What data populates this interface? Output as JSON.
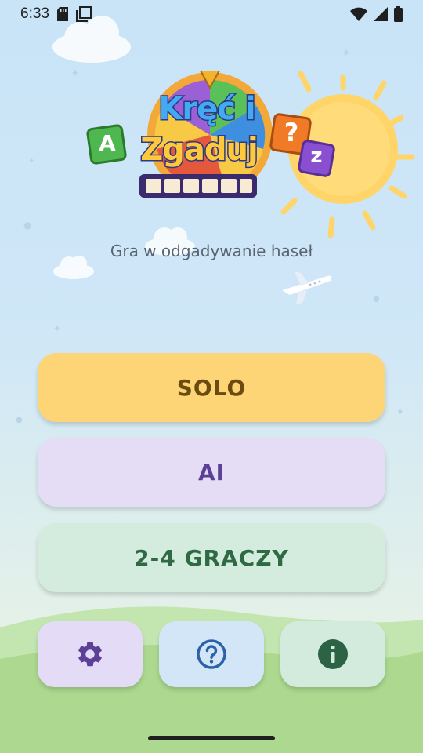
{
  "status_bar": {
    "time": "6:33"
  },
  "logo": {
    "line1": "Kręć i",
    "line2": "Zgaduj",
    "tile_left": "A",
    "tile_question": "?",
    "tile_right": "z"
  },
  "subtitle": "Gra w odgadywanie haseł",
  "modes": {
    "solo": "SOLO",
    "ai": "AI",
    "multiplayer": "2-4 GRACZY"
  },
  "bottom_buttons": {
    "settings_icon": "gear-icon",
    "help_icon": "question-icon",
    "info_icon": "info-icon"
  },
  "colors": {
    "solo": "#fed576",
    "ai": "#e5dcf6",
    "multiplayer": "#d3ecdd"
  }
}
